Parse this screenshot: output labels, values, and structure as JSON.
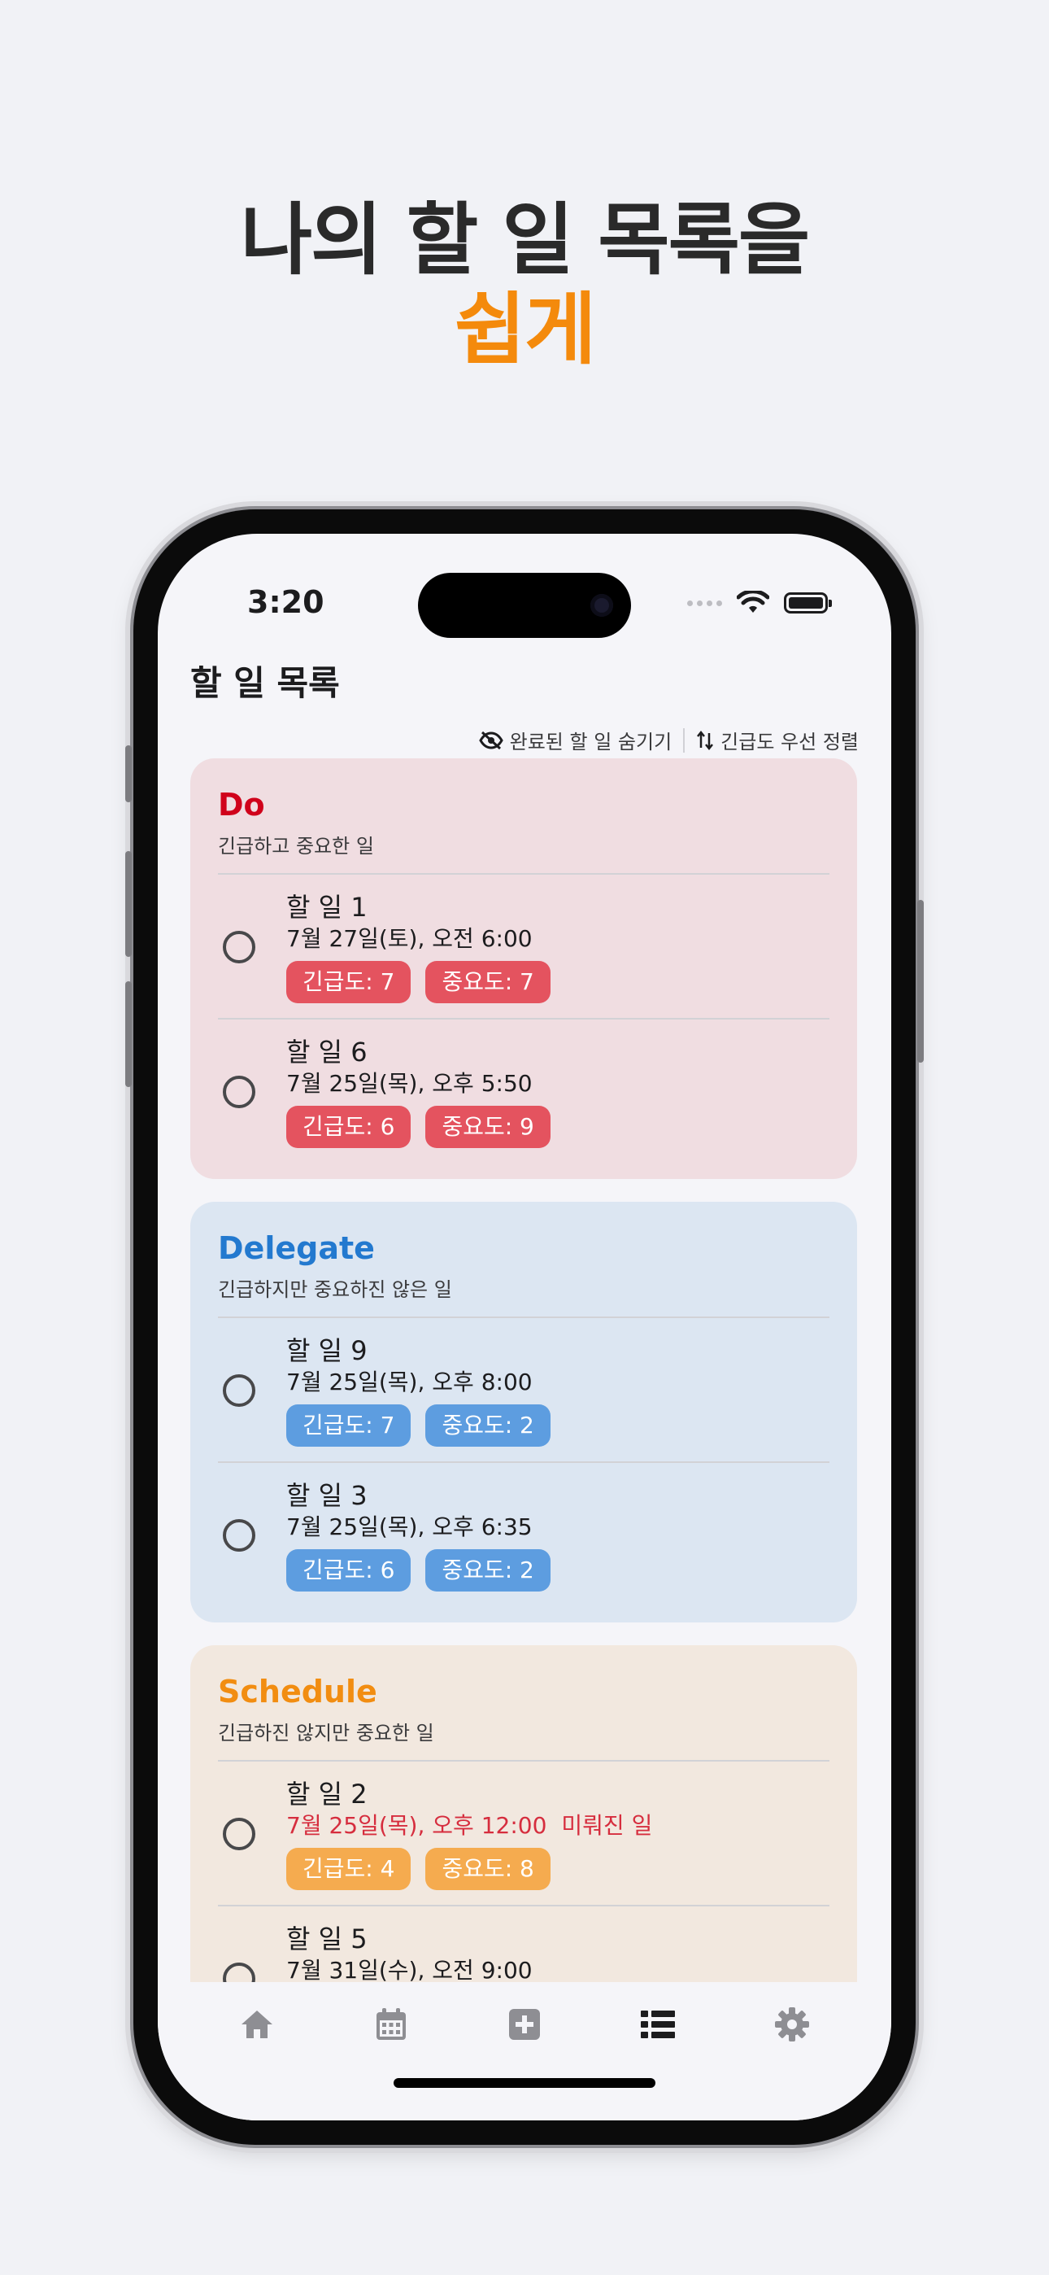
{
  "hero": {
    "line1": "나의 할 일 목록을",
    "line2": "쉽게"
  },
  "status_bar": {
    "time": "3:20"
  },
  "page": {
    "title": "할 일 목록"
  },
  "toolbar": {
    "hide_completed": "완료된 할 일 숨기기",
    "sort_urgency": "긴급도 우선 정렬"
  },
  "colors": {
    "accent_orange": "#f48a0c",
    "do": "#d0021b",
    "delegate": "#2379cf",
    "schedule": "#f28d11"
  },
  "sections": [
    {
      "title": "Do",
      "subtitle": "긴급하고 중요한 일",
      "tasks": [
        {
          "name": "할 일 1",
          "date": "7월 27일(토), 오전 6:00",
          "urgency": "긴급도: 7",
          "importance": "중요도: 7"
        },
        {
          "name": "할 일 6",
          "date": "7월 25일(목), 오후 5:50",
          "urgency": "긴급도: 6",
          "importance": "중요도: 9"
        }
      ]
    },
    {
      "title": "Delegate",
      "subtitle": "긴급하지만 중요하진 않은 일",
      "tasks": [
        {
          "name": "할 일 9",
          "date": "7월 25일(목), 오후 8:00",
          "urgency": "긴급도: 7",
          "importance": "중요도: 2"
        },
        {
          "name": "할 일 3",
          "date": "7월 25일(목), 오후 6:35",
          "urgency": "긴급도: 6",
          "importance": "중요도: 2"
        }
      ]
    },
    {
      "title": "Schedule",
      "subtitle": "긴급하진 않지만 중요한 일",
      "tasks": [
        {
          "name": "할 일 2",
          "date": "7월 25일(목), 오후 12:00",
          "overdue": "미뤄진 일",
          "urgency": "긴급도: 4",
          "importance": "중요도: 8"
        },
        {
          "name": "할 일 5",
          "date": "7월 31일(수), 오전 9:00",
          "urgency": "",
          "importance": ""
        }
      ]
    }
  ],
  "tabbar": {
    "items": [
      "home-icon",
      "calendar-icon",
      "add-icon",
      "list-icon",
      "settings-icon"
    ],
    "active": "list-icon"
  }
}
